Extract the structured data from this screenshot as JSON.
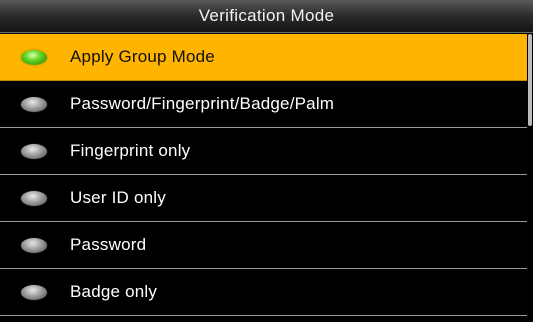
{
  "header": {
    "title": "Verification Mode"
  },
  "options": [
    {
      "label": "Apply Group Mode",
      "selected": true,
      "radio_icon": "radio-selected-icon"
    },
    {
      "label": "Password/Fingerprint/Badge/Palm",
      "selected": false,
      "radio_icon": "radio-unselected-icon"
    },
    {
      "label": "Fingerprint only",
      "selected": false,
      "radio_icon": "radio-unselected-icon"
    },
    {
      "label": "User ID only",
      "selected": false,
      "radio_icon": "radio-unselected-icon"
    },
    {
      "label": "Password",
      "selected": false,
      "radio_icon": "radio-unselected-icon"
    },
    {
      "label": "Badge only",
      "selected": false,
      "radio_icon": "radio-unselected-icon"
    }
  ],
  "colors": {
    "highlight": "#ffb400",
    "background": "#000000",
    "radio_on": "#5fd31e",
    "radio_off": "#9c9c9c"
  }
}
